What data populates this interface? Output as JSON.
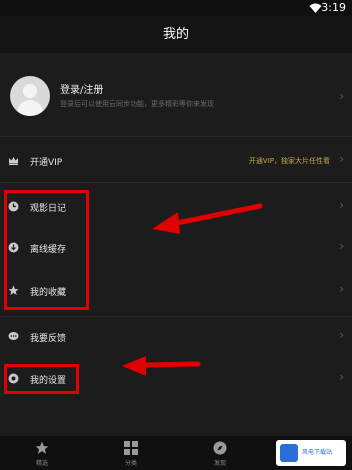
{
  "status": {
    "time": "3:19"
  },
  "header": {
    "title": "我的"
  },
  "profile": {
    "login_label": "登录/注册",
    "subtitle": "登录后可以使用云同步功能，更多精彩等你来发现"
  },
  "menu": [
    {
      "label": "开通VIP",
      "note": "开通VIP，独家大片任性看"
    },
    {
      "label": "观影日记"
    },
    {
      "label": "离线缓存"
    },
    {
      "label": "我的收藏"
    },
    {
      "label": "我要反馈"
    },
    {
      "label": "我的设置"
    }
  ],
  "tabs": [
    {
      "label": "精选"
    },
    {
      "label": "分类"
    },
    {
      "label": "发现"
    }
  ],
  "watermark": {
    "text": "风电下载站"
  },
  "colors": {
    "annotation": "#e00000",
    "vip_gold": "#c8a64a",
    "background": "#1c1c1c"
  },
  "icons": [
    "wifi-icon",
    "crown-icon",
    "clock-icon",
    "download-icon",
    "star-icon",
    "chat-icon",
    "settings-icon",
    "star-tab-icon",
    "grid-icon",
    "compass-icon",
    "chevron-right-icon"
  ]
}
